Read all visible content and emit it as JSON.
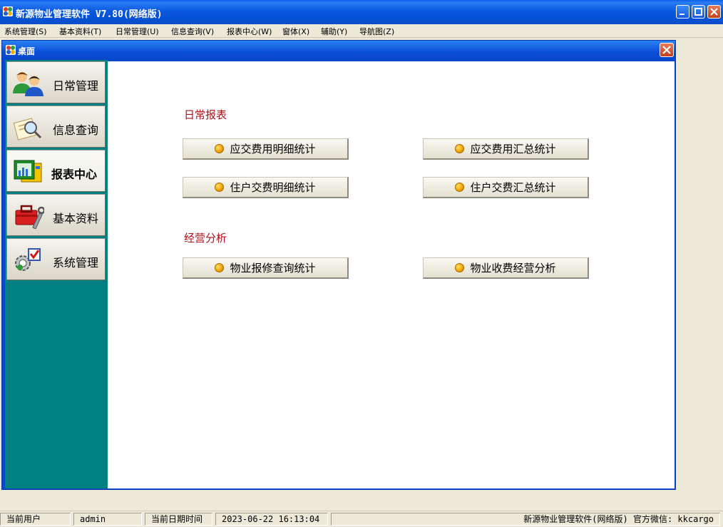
{
  "app": {
    "title": "新源物业管理软件 V7.80(网络版)"
  },
  "menu": [
    "系统管理(S)",
    "基本资料(T)",
    "日常管理(U)",
    "信息查询(V)",
    "报表中心(W)",
    "窗体(X)",
    "辅助(Y)",
    "导航图(Z)"
  ],
  "window": {
    "title": "桌面"
  },
  "nav": [
    {
      "label": "日常管理",
      "icon": "users-icon",
      "active": false
    },
    {
      "label": "信息查询",
      "icon": "search-document-icon",
      "active": false
    },
    {
      "label": "报表中心",
      "icon": "report-chart-icon",
      "active": true
    },
    {
      "label": "基本资料",
      "icon": "toolbox-icon",
      "active": false
    },
    {
      "label": "系统管理",
      "icon": "settings-gear-icon",
      "active": false
    }
  ],
  "sections": [
    {
      "title": "日常报表",
      "buttons": [
        "应交费用明细统计",
        "应交费用汇总统计",
        "住户交费明细统计",
        "住户交费汇总统计"
      ]
    },
    {
      "title": "经营分析",
      "buttons": [
        "物业报修查询统计",
        "物业收费经营分析"
      ]
    }
  ],
  "status": {
    "user_label": "当前用户",
    "user_value": "admin",
    "date_label": "当前日期时间",
    "date_value": "2023-06-22 16:13:04",
    "info": "新源物业管理软件(网络版) 官方微信: kkcargo"
  },
  "colors": {
    "titlebar": "#0a58e0",
    "nav_background": "#008080",
    "section_title": "#b0101a",
    "button_dot": "#f0a000"
  }
}
